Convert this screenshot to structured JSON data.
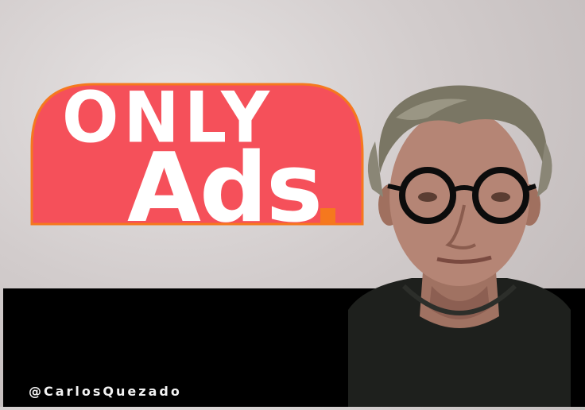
{
  "logo": {
    "line1": "ONLY",
    "line2": "Ads",
    "pill_color": "#f5505a",
    "outline_color": "#f5781e",
    "dot_color": "#f5781e",
    "text_color": "#ffffff"
  },
  "credit": {
    "handle": "@CarlosQuezado"
  },
  "colors": {
    "background": "#d5d0d0",
    "band": "#000000"
  }
}
